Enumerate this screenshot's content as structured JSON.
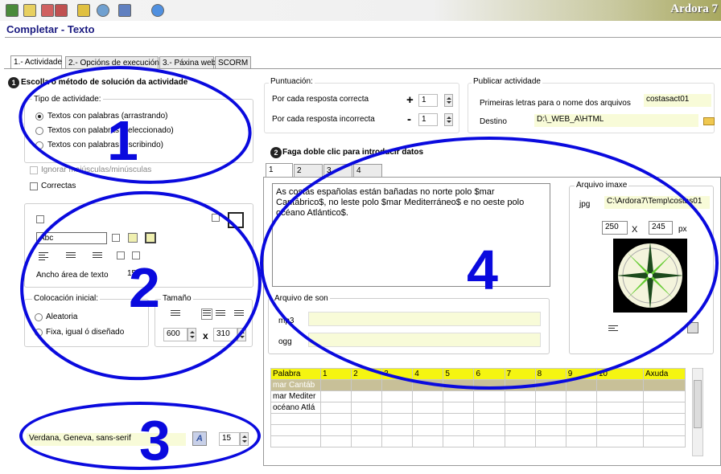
{
  "toolbar": {
    "brand": "Ardora 7"
  },
  "window": {
    "title": "Completar - Texto"
  },
  "tabs": [
    "1.- Actividade",
    "2.- Opcións de execución",
    "3.- Páxina web",
    "SCORM"
  ],
  "left": {
    "heading": "Escolla o método de solución da actividade",
    "type_group": "Tipo de actividade:",
    "type_options": [
      "Textos con palabras (arrastrando)",
      "Textos con palabras (seleccionado)",
      "Textos con palabras (escribindo)"
    ],
    "ignore_case": "Ignorar maiúsculas/minúsculas",
    "correct": "Correctas",
    "style_sample": "Abc",
    "width_label": "Ancho área de texto",
    "width_value": "150",
    "placement_group": "Colocación inicial:",
    "placement_options": [
      "Aleatoria",
      "Fixa, igual ó diseñado"
    ],
    "size_group": "Tamaño",
    "size_w": "600",
    "size_h": "310",
    "font_value": "Verdana, Geneva, sans-serif",
    "font_size": "15"
  },
  "score": {
    "group": "Puntuación:",
    "correct_label": "Por cada resposta correcta",
    "correct_sign": "+",
    "correct_value": "1",
    "wrong_label": "Por cada resposta incorrecta",
    "wrong_sign": "-",
    "wrong_value": "1"
  },
  "publish": {
    "group": "Publicar actividade",
    "prefix_label": "Primeiras letras para o nome dos arquivos",
    "prefix_value": "costasact01",
    "dest_label": "Destino",
    "dest_value": "D:\\_WEB_A\\HTML"
  },
  "data": {
    "heading": "Faga doble clic para introducir datos",
    "subtabs": [
      "1",
      "2",
      "3",
      "4"
    ],
    "text": "As costas españolas están bañadas no norte polo $mar Cantábrico$, no leste polo $mar Mediterráneo$ e no oeste polo océano Atlántico$.",
    "image_group": "Arquivo imaxe",
    "jpg_label": "jpg",
    "jpg_value": "C:\\Ardora7\\Temp\\costas01",
    "img_w": "250",
    "img_x": "X",
    "img_h": "245",
    "img_unit": "px",
    "sound_group": "Arquivo de son",
    "mp3_label": "mp3",
    "ogg_label": "ogg"
  },
  "grid": {
    "headers": [
      "Palabra",
      "1",
      "2",
      "3",
      "4",
      "5",
      "6",
      "7",
      "8",
      "9",
      "10",
      "Axuda"
    ],
    "rows": [
      "mar Cantáb",
      "mar Mediter",
      "océano Atlá"
    ]
  },
  "annotations": [
    "1",
    "2",
    "3",
    "4"
  ],
  "colors": {
    "annotation": "#0a0ade",
    "title": "#1a1a80",
    "grid_header": "#f5f511",
    "selected_row": "#c8c098"
  }
}
